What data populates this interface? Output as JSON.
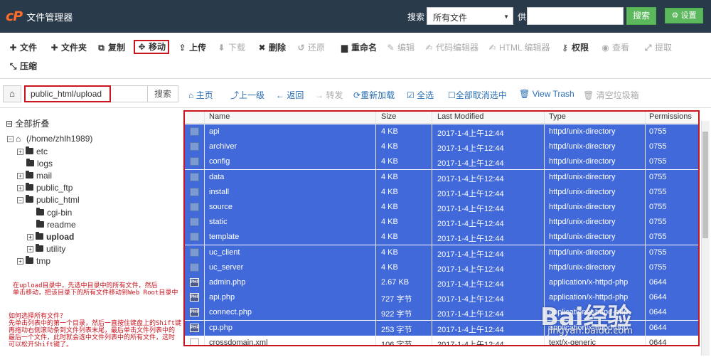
{
  "header": {
    "logo_mark": "cP",
    "app_title": "文件管理器",
    "search_label": "搜索",
    "search_scope": "所有文件",
    "for_label": "供",
    "search_value": "",
    "search_button": "搜索",
    "settings_button": "设置"
  },
  "toolbar": {
    "new_file": "文件",
    "new_folder": "文件夹",
    "copy": "复制",
    "move": "移动",
    "upload": "上传",
    "download": "下载",
    "delete": "删除",
    "restore": "还原",
    "rename": "重命名",
    "edit": "编辑",
    "code_editor": "代码编辑器",
    "html_editor": "HTML 编辑器",
    "permissions": "权限",
    "view": "查看",
    "extract": "提取",
    "compress": "压缩"
  },
  "pathbar": {
    "path_value": "public_html/upload",
    "go_button": "搜索",
    "home": "主页",
    "up_one_level": "上一级",
    "back": "返回",
    "forward": "转发",
    "reload": "重新加载",
    "select_all": "全选",
    "unselect_all": "全部取消选中",
    "view_trash": "View Trash",
    "empty_trash": "清空垃圾箱"
  },
  "tree": {
    "collapse_all": "全部折叠",
    "root": "(/home/zhlh1989)",
    "items": [
      "etc",
      "logs",
      "mail",
      "public_ftp",
      "public_html",
      "cgi-bin",
      "readme",
      "upload",
      "utility",
      "tmp"
    ]
  },
  "notes": {
    "line1": "在upload目录中，先选中目录中的所有文件，然后",
    "line2": "单击移动，把该目录下的所有文件移动到Web Root目录中",
    "line3": "如何选择所有文件？",
    "line4": "先单击列表中的第一个目录，然后一直按住键盘上的Shift键",
    "line5": "再拖动右侧滚动条到文件列表末尾，最后单击文件列表中的",
    "line6": "最后一个文件，此时就会选中文件列表中的所有文件，这时",
    "line7": "可以松开Shift键了。"
  },
  "table": {
    "headers": [
      "Name",
      "Size",
      "Last Modified",
      "Type",
      "Permissions"
    ],
    "rows": [
      {
        "icon": "dir",
        "name": "api",
        "size": "4 KB",
        "modified": "2017-1-4上午12:44",
        "type": "httpd/unix-directory",
        "perm": "0755",
        "selected": true
      },
      {
        "icon": "dir",
        "name": "archiver",
        "size": "4 KB",
        "modified": "2017-1-4上午12:44",
        "type": "httpd/unix-directory",
        "perm": "0755",
        "selected": true
      },
      {
        "icon": "dir",
        "name": "config",
        "size": "4 KB",
        "modified": "2017-1-4上午12:44",
        "type": "httpd/unix-directory",
        "perm": "0755",
        "selected": true
      },
      {
        "icon": "dir",
        "name": "data",
        "size": "4 KB",
        "modified": "2017-1-4上午12:44",
        "type": "httpd/unix-directory",
        "perm": "0755",
        "selected": true
      },
      {
        "icon": "dir",
        "name": "install",
        "size": "4 KB",
        "modified": "2017-1-4上午12:44",
        "type": "httpd/unix-directory",
        "perm": "0755",
        "selected": true
      },
      {
        "icon": "dir",
        "name": "source",
        "size": "4 KB",
        "modified": "2017-1-4上午12:44",
        "type": "httpd/unix-directory",
        "perm": "0755",
        "selected": true
      },
      {
        "icon": "dir",
        "name": "static",
        "size": "4 KB",
        "modified": "2017-1-4上午12:44",
        "type": "httpd/unix-directory",
        "perm": "0755",
        "selected": true
      },
      {
        "icon": "dir",
        "name": "template",
        "size": "4 KB",
        "modified": "2017-1-4上午12:44",
        "type": "httpd/unix-directory",
        "perm": "0755",
        "selected": true
      },
      {
        "icon": "dir",
        "name": "uc_client",
        "size": "4 KB",
        "modified": "2017-1-4上午12:44",
        "type": "httpd/unix-directory",
        "perm": "0755",
        "selected": true
      },
      {
        "icon": "dir",
        "name": "uc_server",
        "size": "4 KB",
        "modified": "2017-1-4上午12:44",
        "type": "httpd/unix-directory",
        "perm": "0755",
        "selected": true
      },
      {
        "icon": "php",
        "name": "admin.php",
        "size": "2.67 KB",
        "modified": "2017-1-4上午12:44",
        "type": "application/x-httpd-php",
        "perm": "0644",
        "selected": true
      },
      {
        "icon": "php",
        "name": "api.php",
        "size": "727 字节",
        "modified": "2017-1-4上午12:44",
        "type": "application/x-httpd-php",
        "perm": "0644",
        "selected": true
      },
      {
        "icon": "php",
        "name": "connect.php",
        "size": "922 字节",
        "modified": "2017-1-4上午12:44",
        "type": "application/x-httpd-php",
        "perm": "0644",
        "selected": true
      },
      {
        "icon": "php",
        "name": "cp.php",
        "size": "253 字节",
        "modified": "2017-1-4上午12:44",
        "type": "application/x-httpd-php",
        "perm": "0644",
        "selected": true
      },
      {
        "icon": "txt",
        "name": "crossdomain.xml",
        "size": "106 字节",
        "modified": "2017-1-4上午12:44",
        "type": "text/x-generic",
        "perm": "0644",
        "selected": false
      }
    ]
  },
  "watermark": {
    "text": "Bai经验",
    "url": "jingyan.baidu.com"
  },
  "colors": {
    "header_bg": "#293a4a",
    "accent_green": "#5cb85c",
    "selected_row": "#4169d9",
    "highlight_red": "#c9151e",
    "link_blue": "#2a6fb5"
  }
}
